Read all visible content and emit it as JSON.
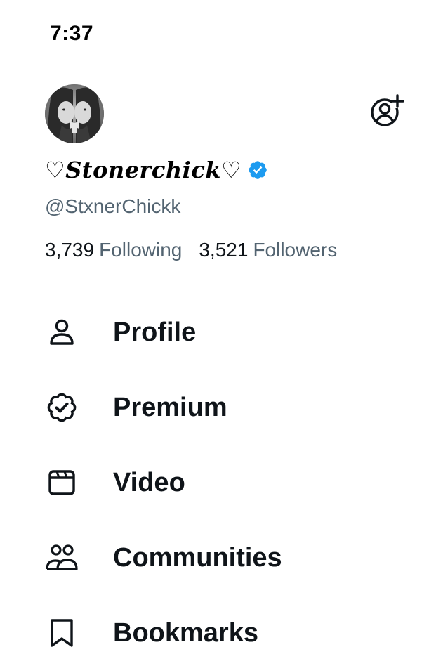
{
  "status_bar": {
    "time": "7:37"
  },
  "profile": {
    "avatar_icon": "user-avatar-photo",
    "display_name": "♡𝑺𝒕𝒐𝒏𝒆𝒓𝒄𝒉𝒊𝒄𝒌♡",
    "verified": true,
    "verified_color": "#1d9bf0",
    "handle": "@StxnerChickk",
    "following_count": "3,739",
    "following_label": "Following",
    "followers_count": "3,521",
    "followers_label": "Followers",
    "add_account_icon": "add-account-icon"
  },
  "menu": {
    "items": [
      {
        "label": "Profile",
        "icon": "person-icon"
      },
      {
        "label": "Premium",
        "icon": "verified-badge-outline-icon"
      },
      {
        "label": "Video",
        "icon": "video-clapper-icon"
      },
      {
        "label": "Communities",
        "icon": "communities-icon"
      },
      {
        "label": "Bookmarks",
        "icon": "bookmark-icon"
      }
    ]
  },
  "colors": {
    "text_primary": "#0f1419",
    "text_secondary": "#536471",
    "accent": "#1d9bf0",
    "background": "#ffffff"
  }
}
